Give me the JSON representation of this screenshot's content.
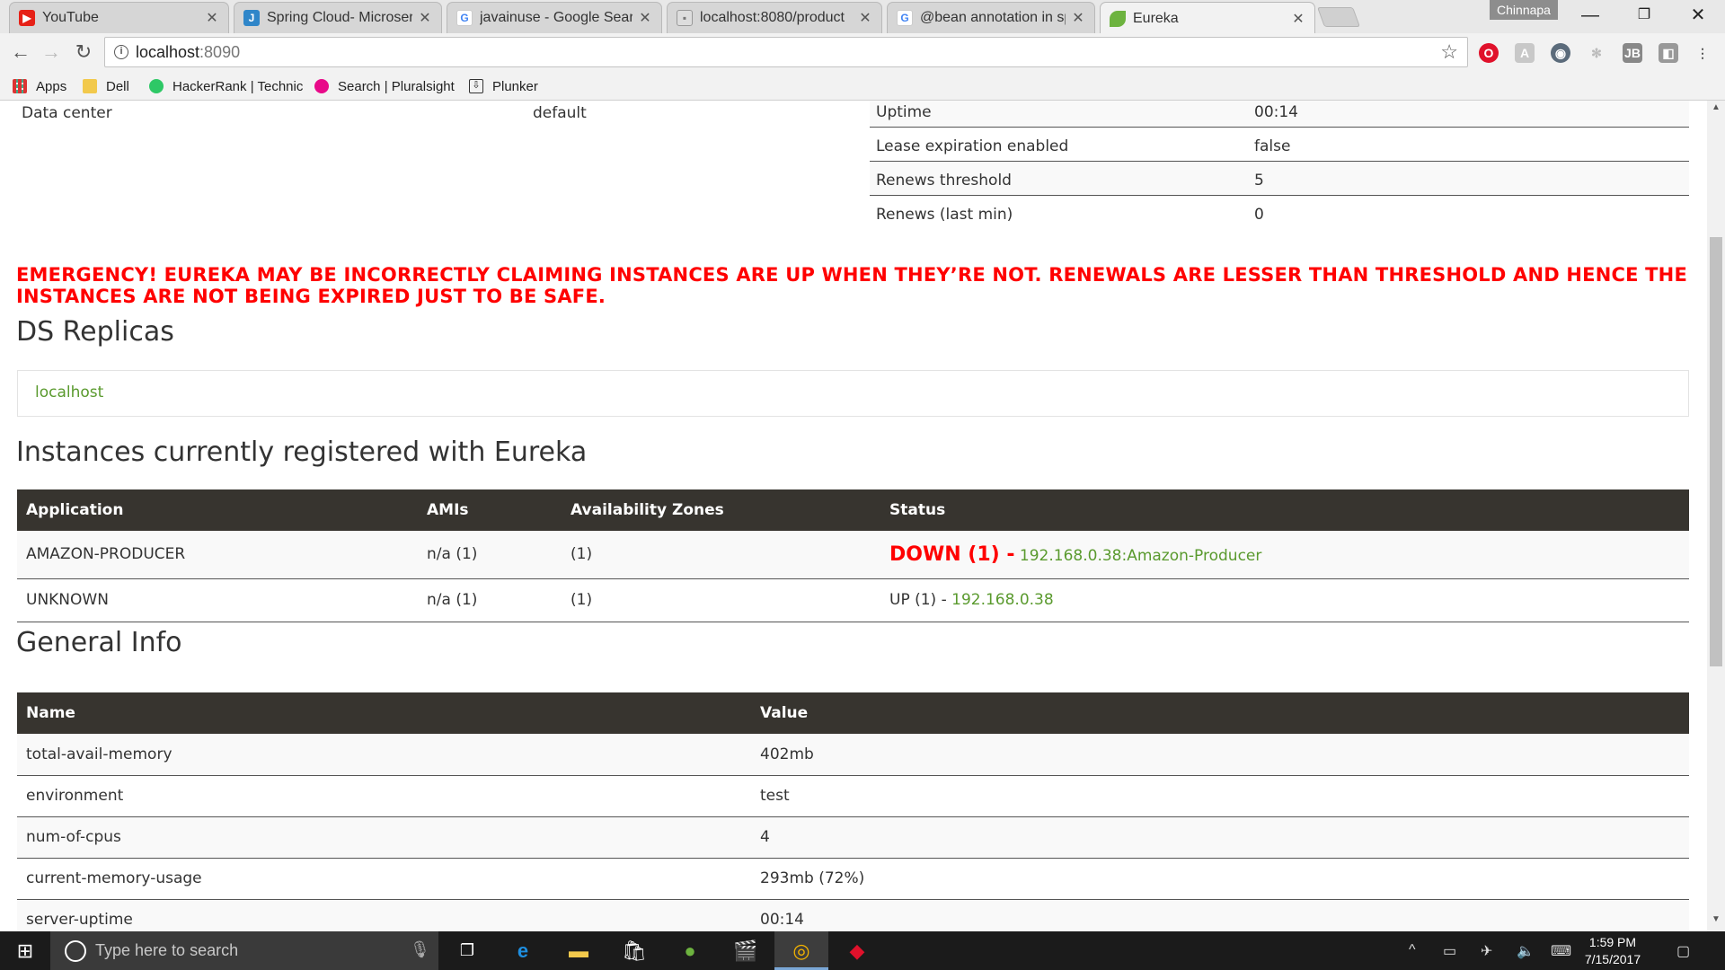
{
  "browser": {
    "tabs": [
      {
        "title": "YouTube",
        "icon": "youtube-icon",
        "color": "#e62117"
      },
      {
        "title": "Spring Cloud- Microservi",
        "icon": "javainuse-icon",
        "color": "#2f86c9"
      },
      {
        "title": "javainuse - Google Searc",
        "icon": "google-icon",
        "color": "#4285f4"
      },
      {
        "title": "localhost:8080/product",
        "icon": "broken-image-icon",
        "color": "#9a9a9a"
      },
      {
        "title": "@bean annotation in spr",
        "icon": "google-icon",
        "color": "#4285f4"
      },
      {
        "title": "Eureka",
        "icon": "spring-leaf-icon",
        "color": "#6db33f"
      }
    ],
    "profile_name": "Chinnapa",
    "url_host": "localhost",
    "url_port": ":8090",
    "bookmarks": [
      "Apps",
      "Dell",
      "HackerRank | Technic",
      "Search | Pluralsight",
      "Plunker"
    ]
  },
  "system_status": {
    "left": {
      "label": "Data center",
      "value": "default"
    },
    "rows": [
      {
        "label": "Uptime",
        "value": "00:14"
      },
      {
        "label": "Lease expiration enabled",
        "value": "false"
      },
      {
        "label": "Renews threshold",
        "value": "5"
      },
      {
        "label": "Renews (last min)",
        "value": "0"
      }
    ]
  },
  "emergency_message": "EMERGENCY! EUREKA MAY BE INCORRECTLY CLAIMING INSTANCES ARE UP WHEN THEY’RE NOT. RENEWALS ARE LESSER THAN THRESHOLD AND HENCE THE INSTANCES ARE NOT BEING EXPIRED JUST TO BE SAFE.",
  "replicas": {
    "heading": "DS Replicas",
    "items": [
      "localhost"
    ]
  },
  "instances": {
    "heading": "Instances currently registered with Eureka",
    "columns": [
      "Application",
      "AMIs",
      "Availability Zones",
      "Status"
    ],
    "rows": [
      {
        "application": "AMAZON-PRODUCER",
        "amis": "n/a (1)",
        "zones": "(1)",
        "status": "DOWN (1) -",
        "link": "192.168.0.38:Amazon-Producer"
      },
      {
        "application": "UNKNOWN",
        "amis": "n/a (1)",
        "zones": "(1)",
        "status": "UP (1) -",
        "link": "192.168.0.38"
      }
    ]
  },
  "general_info": {
    "heading": "General Info",
    "columns": [
      "Name",
      "Value"
    ],
    "rows": [
      {
        "name": "total-avail-memory",
        "value": "402mb"
      },
      {
        "name": "environment",
        "value": "test"
      },
      {
        "name": "num-of-cpus",
        "value": "4"
      },
      {
        "name": "current-memory-usage",
        "value": "293mb (72%)"
      },
      {
        "name": "server-uptime",
        "value": "00:14"
      }
    ]
  },
  "taskbar": {
    "search_placeholder": "Type here to search",
    "time": "1:59 PM",
    "date": "7/15/2017"
  },
  "colors": {
    "emergency": "#ff0000",
    "link_green": "#5a9a2e",
    "table_header": "#37342f"
  }
}
